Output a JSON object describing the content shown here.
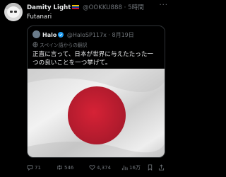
{
  "tweet": {
    "author_name": "Damity Light",
    "author_handle": "@OOKKU888",
    "separator": "·",
    "time": "5時間",
    "text": "Futanari"
  },
  "quote": {
    "author_name": "Halo",
    "author_handle": "@HaloSP117x",
    "separator": "·",
    "date": "8月19日",
    "translation_note": "スペイン語からの翻訳",
    "text_line1": "正直に言って、日本が世界に与えたたった一",
    "text_line2": "つの良いことを一つ挙げて。"
  },
  "actions": {
    "replies": "71",
    "retweets": "546",
    "likes": "4,374",
    "views": "16万"
  },
  "colors": {
    "background": "#000000",
    "secondary_text": "#71767b",
    "verified_blue": "#1d9bf0",
    "flag_red": "#bc1e32"
  }
}
